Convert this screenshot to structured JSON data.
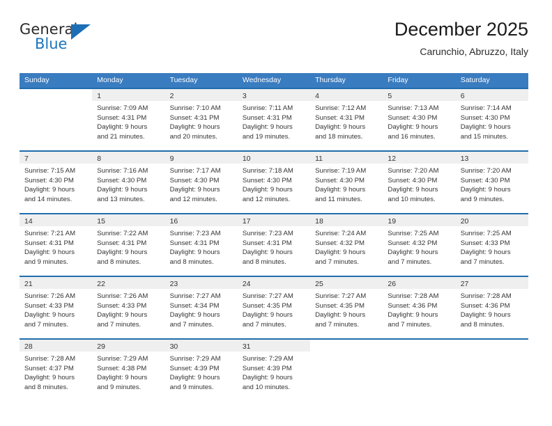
{
  "brand": {
    "name_part1": "General",
    "name_part2": "Blue",
    "triangle_color": "#1c6fb5",
    "blue_color": "#1c75bc"
  },
  "header": {
    "title": "December 2025",
    "subtitle": "Carunchio, Abruzzo, Italy"
  },
  "theme": {
    "header_row_bg": "#3a7cc0",
    "week_separator": "#1f6cad",
    "day_number_band": "#efefef",
    "text": "#333333"
  },
  "weekdays": [
    "Sunday",
    "Monday",
    "Tuesday",
    "Wednesday",
    "Thursday",
    "Friday",
    "Saturday"
  ],
  "weeks": [
    [
      {
        "day": "",
        "lines": []
      },
      {
        "day": "1",
        "lines": [
          "Sunrise: 7:09 AM",
          "Sunset: 4:31 PM",
          "Daylight: 9 hours",
          "and 21 minutes."
        ]
      },
      {
        "day": "2",
        "lines": [
          "Sunrise: 7:10 AM",
          "Sunset: 4:31 PM",
          "Daylight: 9 hours",
          "and 20 minutes."
        ]
      },
      {
        "day": "3",
        "lines": [
          "Sunrise: 7:11 AM",
          "Sunset: 4:31 PM",
          "Daylight: 9 hours",
          "and 19 minutes."
        ]
      },
      {
        "day": "4",
        "lines": [
          "Sunrise: 7:12 AM",
          "Sunset: 4:31 PM",
          "Daylight: 9 hours",
          "and 18 minutes."
        ]
      },
      {
        "day": "5",
        "lines": [
          "Sunrise: 7:13 AM",
          "Sunset: 4:30 PM",
          "Daylight: 9 hours",
          "and 16 minutes."
        ]
      },
      {
        "day": "6",
        "lines": [
          "Sunrise: 7:14 AM",
          "Sunset: 4:30 PM",
          "Daylight: 9 hours",
          "and 15 minutes."
        ]
      }
    ],
    [
      {
        "day": "7",
        "lines": [
          "Sunrise: 7:15 AM",
          "Sunset: 4:30 PM",
          "Daylight: 9 hours",
          "and 14 minutes."
        ]
      },
      {
        "day": "8",
        "lines": [
          "Sunrise: 7:16 AM",
          "Sunset: 4:30 PM",
          "Daylight: 9 hours",
          "and 13 minutes."
        ]
      },
      {
        "day": "9",
        "lines": [
          "Sunrise: 7:17 AM",
          "Sunset: 4:30 PM",
          "Daylight: 9 hours",
          "and 12 minutes."
        ]
      },
      {
        "day": "10",
        "lines": [
          "Sunrise: 7:18 AM",
          "Sunset: 4:30 PM",
          "Daylight: 9 hours",
          "and 12 minutes."
        ]
      },
      {
        "day": "11",
        "lines": [
          "Sunrise: 7:19 AM",
          "Sunset: 4:30 PM",
          "Daylight: 9 hours",
          "and 11 minutes."
        ]
      },
      {
        "day": "12",
        "lines": [
          "Sunrise: 7:20 AM",
          "Sunset: 4:30 PM",
          "Daylight: 9 hours",
          "and 10 minutes."
        ]
      },
      {
        "day": "13",
        "lines": [
          "Sunrise: 7:20 AM",
          "Sunset: 4:30 PM",
          "Daylight: 9 hours",
          "and 9 minutes."
        ]
      }
    ],
    [
      {
        "day": "14",
        "lines": [
          "Sunrise: 7:21 AM",
          "Sunset: 4:31 PM",
          "Daylight: 9 hours",
          "and 9 minutes."
        ]
      },
      {
        "day": "15",
        "lines": [
          "Sunrise: 7:22 AM",
          "Sunset: 4:31 PM",
          "Daylight: 9 hours",
          "and 8 minutes."
        ]
      },
      {
        "day": "16",
        "lines": [
          "Sunrise: 7:23 AM",
          "Sunset: 4:31 PM",
          "Daylight: 9 hours",
          "and 8 minutes."
        ]
      },
      {
        "day": "17",
        "lines": [
          "Sunrise: 7:23 AM",
          "Sunset: 4:31 PM",
          "Daylight: 9 hours",
          "and 8 minutes."
        ]
      },
      {
        "day": "18",
        "lines": [
          "Sunrise: 7:24 AM",
          "Sunset: 4:32 PM",
          "Daylight: 9 hours",
          "and 7 minutes."
        ]
      },
      {
        "day": "19",
        "lines": [
          "Sunrise: 7:25 AM",
          "Sunset: 4:32 PM",
          "Daylight: 9 hours",
          "and 7 minutes."
        ]
      },
      {
        "day": "20",
        "lines": [
          "Sunrise: 7:25 AM",
          "Sunset: 4:33 PM",
          "Daylight: 9 hours",
          "and 7 minutes."
        ]
      }
    ],
    [
      {
        "day": "21",
        "lines": [
          "Sunrise: 7:26 AM",
          "Sunset: 4:33 PM",
          "Daylight: 9 hours",
          "and 7 minutes."
        ]
      },
      {
        "day": "22",
        "lines": [
          "Sunrise: 7:26 AM",
          "Sunset: 4:33 PM",
          "Daylight: 9 hours",
          "and 7 minutes."
        ]
      },
      {
        "day": "23",
        "lines": [
          "Sunrise: 7:27 AM",
          "Sunset: 4:34 PM",
          "Daylight: 9 hours",
          "and 7 minutes."
        ]
      },
      {
        "day": "24",
        "lines": [
          "Sunrise: 7:27 AM",
          "Sunset: 4:35 PM",
          "Daylight: 9 hours",
          "and 7 minutes."
        ]
      },
      {
        "day": "25",
        "lines": [
          "Sunrise: 7:27 AM",
          "Sunset: 4:35 PM",
          "Daylight: 9 hours",
          "and 7 minutes."
        ]
      },
      {
        "day": "26",
        "lines": [
          "Sunrise: 7:28 AM",
          "Sunset: 4:36 PM",
          "Daylight: 9 hours",
          "and 7 minutes."
        ]
      },
      {
        "day": "27",
        "lines": [
          "Sunrise: 7:28 AM",
          "Sunset: 4:36 PM",
          "Daylight: 9 hours",
          "and 8 minutes."
        ]
      }
    ],
    [
      {
        "day": "28",
        "lines": [
          "Sunrise: 7:28 AM",
          "Sunset: 4:37 PM",
          "Daylight: 9 hours",
          "and 8 minutes."
        ]
      },
      {
        "day": "29",
        "lines": [
          "Sunrise: 7:29 AM",
          "Sunset: 4:38 PM",
          "Daylight: 9 hours",
          "and 9 minutes."
        ]
      },
      {
        "day": "30",
        "lines": [
          "Sunrise: 7:29 AM",
          "Sunset: 4:39 PM",
          "Daylight: 9 hours",
          "and 9 minutes."
        ]
      },
      {
        "day": "31",
        "lines": [
          "Sunrise: 7:29 AM",
          "Sunset: 4:39 PM",
          "Daylight: 9 hours",
          "and 10 minutes."
        ]
      },
      {
        "day": "",
        "lines": []
      },
      {
        "day": "",
        "lines": []
      },
      {
        "day": "",
        "lines": []
      }
    ]
  ]
}
